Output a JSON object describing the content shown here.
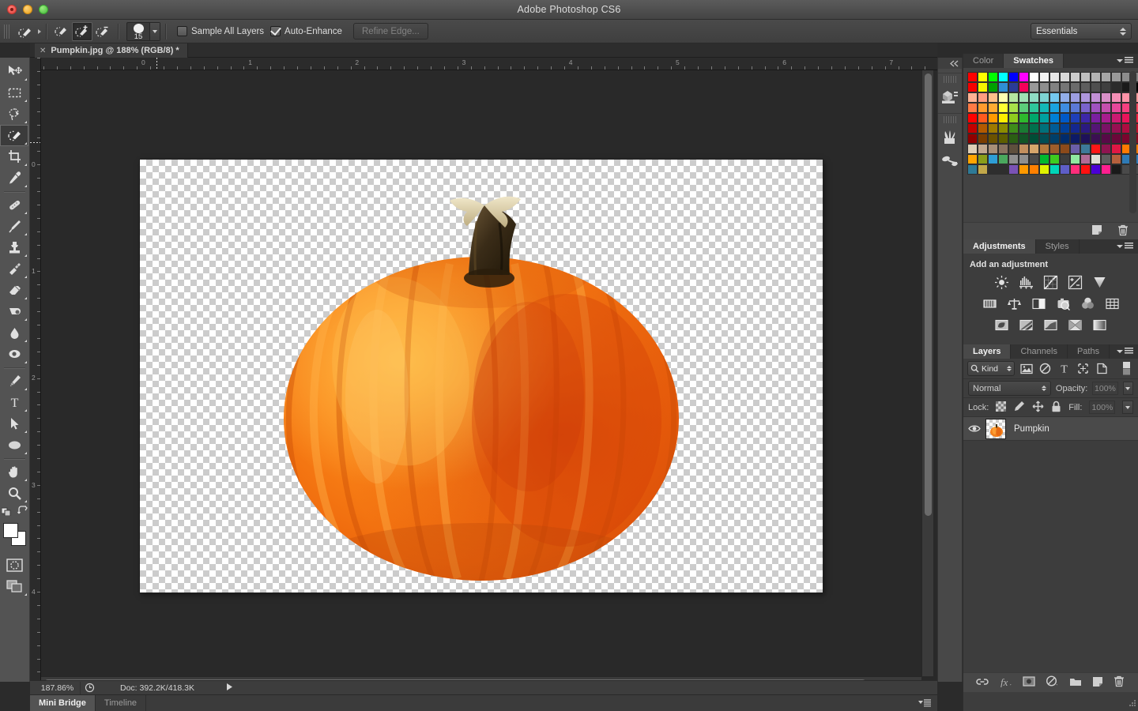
{
  "window": {
    "title": "Adobe Photoshop CS6",
    "traffic": [
      "close",
      "minimize",
      "maximize"
    ]
  },
  "options_bar": {
    "tool_preset_icon": "quick-selection-tool-icon",
    "modes": [
      "new-selection",
      "add-to-selection",
      "subtract-from-selection"
    ],
    "active_mode_index": 1,
    "brush_size": "15",
    "sample_all_layers": {
      "label": "Sample All Layers",
      "checked": false
    },
    "auto_enhance": {
      "label": "Auto-Enhance",
      "checked": true
    },
    "refine_edge": {
      "label": "Refine Edge...",
      "enabled": false
    },
    "workspace": "Essentials"
  },
  "document_tab": {
    "close_glyph": "✕",
    "label": "Pumpkin.jpg @ 188% (RGB/8) *"
  },
  "toolbox": {
    "tools": [
      {
        "name": "move-tool",
        "selected": false
      },
      {
        "name": "rectangular-marquee-tool",
        "selected": false
      },
      {
        "name": "lasso-tool",
        "selected": false
      },
      {
        "name": "quick-selection-tool",
        "selected": true
      },
      {
        "name": "crop-tool",
        "selected": false
      },
      {
        "name": "eyedropper-tool",
        "selected": false
      },
      {
        "name": "spot-healing-brush-tool",
        "selected": false
      },
      {
        "name": "brush-tool",
        "selected": false
      },
      {
        "name": "clone-stamp-tool",
        "selected": false
      },
      {
        "name": "history-brush-tool",
        "selected": false
      },
      {
        "name": "eraser-tool",
        "selected": false
      },
      {
        "name": "gradient-tool",
        "selected": false
      },
      {
        "name": "blur-tool",
        "selected": false
      },
      {
        "name": "dodge-tool",
        "selected": false
      },
      {
        "name": "pen-tool",
        "selected": false
      },
      {
        "name": "horizontal-type-tool",
        "selected": false
      },
      {
        "name": "path-selection-tool",
        "selected": false
      },
      {
        "name": "ellipse-tool",
        "selected": false
      },
      {
        "name": "hand-tool",
        "selected": false
      },
      {
        "name": "zoom-tool",
        "selected": false
      }
    ],
    "foreground_color": "#ffffff",
    "background_color": "#ffffff",
    "quick_mask": "edit-in-quick-mask-mode",
    "screen_mode": "change-screen-mode"
  },
  "rulers": {
    "unit": "inches",
    "horizontal_labels": [
      "0",
      "1",
      "2",
      "3",
      "4",
      "5",
      "6",
      "7"
    ],
    "vertical_labels": [
      "0",
      "1",
      "2",
      "3",
      "4"
    ]
  },
  "canvas": {
    "image_name": "Pumpkin",
    "transparent_background": true,
    "checker_light": "#ffffff",
    "checker_dark": "#cccccc"
  },
  "status_bar": {
    "zoom": "187.86%",
    "doc_info": "Doc: 392.2K/418.3K"
  },
  "bottom_tabs": [
    {
      "label": "Mini Bridge",
      "active": true
    },
    {
      "label": "Timeline",
      "active": false
    }
  ],
  "mini_dock": {
    "items": [
      "mini-bridge-icon",
      "brush-presets-icon",
      "tool-presets-icon"
    ],
    "collapse": "collapse-to-icons"
  },
  "panels": {
    "color_swatches": {
      "tabs": [
        {
          "label": "Color",
          "active": false
        },
        {
          "label": "Swatches",
          "active": true
        }
      ],
      "footer": [
        "new-swatch-icon",
        "delete-swatch-icon"
      ],
      "colors": [
        "#ff0000",
        "#ffff00",
        "#00ff00",
        "#00ffff",
        "#0000ff",
        "#ff00ff",
        "#ffffff",
        "#f2f2f2",
        "#e6e6e6",
        "#d9d9d9",
        "#cccccc",
        "#bfbfbf",
        "#b3b3b3",
        "#a6a6a6",
        "#999999",
        "#8c8c8c",
        "#808080",
        "#f50000",
        "#f5f500",
        "#00a000",
        "#2e8fd6",
        "#2a3b96",
        "#f5005a",
        "#999999",
        "#8f8f8f",
        "#828282",
        "#767676",
        "#6b6b6b",
        "#5e5e5e",
        "#4f4f4f",
        "#3f3f3f",
        "#2b2b2b",
        "#1a1a1a",
        "#000000",
        "#ffb293",
        "#ff9e80",
        "#ffc08a",
        "#ffffb0",
        "#b6e6a0",
        "#9fe0b4",
        "#8fdcc4",
        "#7ed3d3",
        "#74c8ef",
        "#92aee8",
        "#9d9ee2",
        "#ae97dd",
        "#c290d6",
        "#d98fc8",
        "#f48fb6",
        "#ff93a8",
        "#ff9b9b",
        "#ff7a45",
        "#ff9b2e",
        "#ffab33",
        "#ffff33",
        "#a8e04a",
        "#5ccc7a",
        "#2ec79b",
        "#14b8b8",
        "#1aa3e0",
        "#3f8de0",
        "#5b79d6",
        "#7a63cc",
        "#a052bf",
        "#c44fae",
        "#e8489b",
        "#f74080",
        "#ff4a5e",
        "#ff0000",
        "#ff5a1e",
        "#ff9a00",
        "#ffee00",
        "#8fcc1e",
        "#2eb82e",
        "#00a86b",
        "#00a0a0",
        "#0080d6",
        "#0059c7",
        "#1f3fb8",
        "#3d27a8",
        "#7a1fa0",
        "#a81d8e",
        "#cc1a72",
        "#e8145a",
        "#ff1f3d",
        "#c20000",
        "#b35a00",
        "#9e7a00",
        "#8c8c00",
        "#3f8c1a",
        "#1a7a33",
        "#00704d",
        "#00707a",
        "#005c96",
        "#003f99",
        "#14278f",
        "#2b1a80",
        "#541575",
        "#7a1266",
        "#960f52",
        "#ad0c40",
        "#c20f28",
        "#8f0000",
        "#7a3d00",
        "#6b5200",
        "#5e5e00",
        "#2b5e14",
        "#125426",
        "#004d36",
        "#004d54",
        "#003f69",
        "#002b6b",
        "#0d1a66",
        "#1e1159",
        "#3b0f52",
        "#570a47",
        "#6b0739",
        "#7a052d",
        "#8a0a1e",
        "#ded0b8",
        "#c2a98f",
        "#a88f78",
        "#8a7360",
        "#5e4f3d",
        "#c28f5e",
        "#d6a66b",
        "#b5793d",
        "#9e5e2b",
        "#8c4a1a",
        "#6b5ea8",
        "#3d7a99",
        "#ff1717",
        "#8f1450",
        "#e01744",
        "#ff7a00",
        "#ff7a00",
        "#ffa500",
        "#8a9e1a",
        "#2e9ed6",
        "#4aa85e",
        "#8f8f8f",
        "#8f8f8f",
        "#4a4a4a",
        "#00b82e",
        "#3dcc1f",
        "#3d3d3d",
        "#8fe8a0",
        "#b06b96",
        "#e0e0d6",
        "#5e5e5e",
        "#b5603d",
        "#2e7ab5",
        "#2e7ab5",
        "#2e7a96",
        "#c2a84a",
        "#2e2e2e",
        "#2e2e2e",
        "#7a52b5",
        "#ff9900",
        "#ff8000",
        "#e0f200",
        "#00d6b8",
        "#5e5ec7",
        "#ff2e7a",
        "#ff1111",
        "#4a00d6",
        "#ff1f8f",
        "#1a1a1a",
        "#4a4a4a",
        "#4a4a4a"
      ]
    },
    "adjustments": {
      "tabs": [
        {
          "label": "Adjustments",
          "active": true
        },
        {
          "label": "Styles",
          "active": false
        }
      ],
      "title": "Add an adjustment",
      "rows": [
        [
          "brightness-contrast-icon",
          "levels-icon",
          "curves-icon",
          "exposure-icon",
          "vibrance-icon"
        ],
        [
          "hue-saturation-icon",
          "color-balance-icon",
          "black-white-icon",
          "photo-filter-icon",
          "channel-mixer-icon",
          "color-lookup-icon"
        ],
        [
          "invert-icon",
          "posterize-icon",
          "threshold-icon",
          "gradient-map-icon",
          "selective-color-icon"
        ]
      ]
    },
    "layers": {
      "tabs": [
        {
          "label": "Layers",
          "active": true
        },
        {
          "label": "Channels",
          "active": false
        },
        {
          "label": "Paths",
          "active": false
        }
      ],
      "filter": {
        "kind_label": "Kind",
        "icons": [
          "filter-pixel-icon",
          "filter-adjustment-icon",
          "filter-type-icon",
          "filter-shape-icon",
          "filter-smart-object-icon"
        ],
        "toggle": "filter-toggle-icon"
      },
      "blend_mode": "Normal",
      "opacity_label": "Opacity:",
      "opacity_value": "100%",
      "lock_label": "Lock:",
      "lock_icons": [
        "lock-transparent-pixels-icon",
        "lock-image-pixels-icon",
        "lock-position-icon",
        "lock-all-icon"
      ],
      "fill_label": "Fill:",
      "fill_value": "100%",
      "rows": [
        {
          "name": "Pumpkin",
          "visible": true,
          "selected": true
        }
      ],
      "footer": [
        "link-layers-icon",
        "add-layer-style-icon",
        "add-layer-mask-icon",
        "new-adjustment-layer-icon",
        "new-group-icon",
        "new-layer-icon",
        "delete-layer-icon"
      ]
    }
  }
}
